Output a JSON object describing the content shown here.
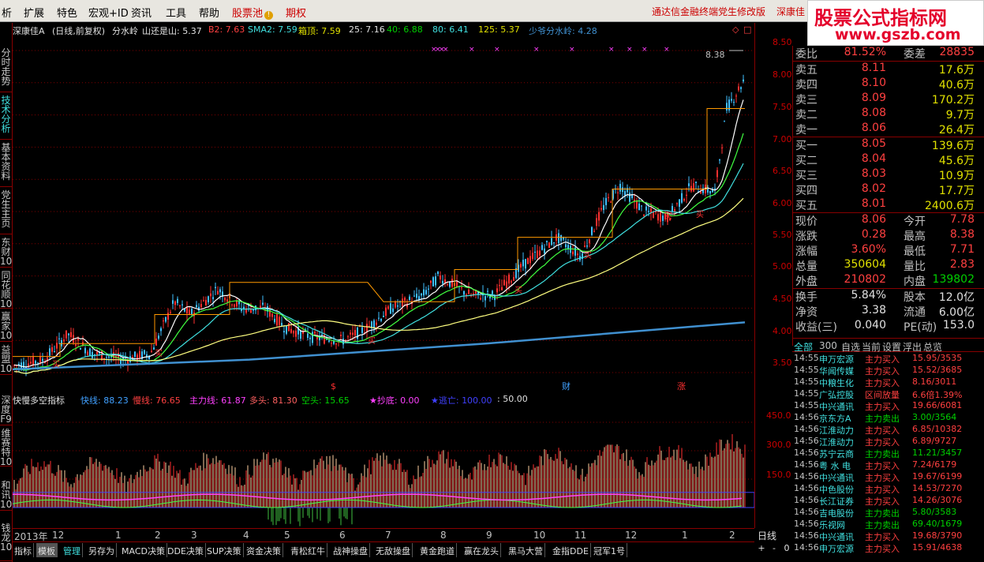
{
  "menu": [
    {
      "id": "xi",
      "label": "析"
    },
    {
      "id": "kuozhan",
      "label": "扩展"
    },
    {
      "id": "tese",
      "label": "特色"
    },
    {
      "id": "hongguan",
      "label": "宏观+ID"
    },
    {
      "id": "zixun",
      "label": "资讯"
    },
    {
      "id": "gongju",
      "label": "工具"
    },
    {
      "id": "bangzhu",
      "label": "帮助"
    }
  ],
  "stock_pool_label": "股票池",
  "rights_label": "期权",
  "top_note": "通达信金融终端党生修改版",
  "top_user": "深康佳",
  "logo": {
    "line1": "股票公式指标网",
    "line2": "www.gszb.com"
  },
  "left_tabs": [
    "分时走势",
    "技术分析",
    "基本资料",
    "党生主页",
    "东财10",
    "同花顺10",
    "赢家10",
    "益盟10",
    "深度F9",
    "维赛特10",
    "和讯10",
    "钱龙10"
  ],
  "chart_header": {
    "title": "深康佳A",
    "mode": "(日线,前复权)",
    "formula": "分水岭",
    "b1": "山还是山: 5.37",
    "b2": "B2: 7.63",
    "sma2": "SMA2: 7.59",
    "box": "箱顶: 7.59",
    "m25": "25: 7.16",
    "m40": "40: 6.88",
    "m80": "80: 6.41",
    "m125": "125: 5.37",
    "sfs": "少爷分水岭: 4.28"
  },
  "price_axis": [
    "8.50",
    "8.00",
    "7.50",
    "7.00",
    "6.50",
    "6.00",
    "5.50",
    "5.00",
    "4.50",
    "4.00",
    "3.50"
  ],
  "high_label": "8.38",
  "event_marks": {
    "s": "$",
    "cai": "财",
    "zhang": "涨"
  },
  "buy_labels": [
    "买",
    "买",
    "买",
    "买",
    "买",
    "买",
    "买"
  ],
  "sub_header": {
    "name": "快慢多空指标",
    "fast": "快线: 88.23",
    "slow": "慢线: 76.65",
    "main": "主力线: 61.87",
    "long": "多头: 81.30",
    "short": "空头: 15.65",
    "bottom": "★抄底: 0.00",
    "escape": "★逃亡: 100.00",
    "fifty": ": 50.00"
  },
  "sub_axis": [
    "450.0",
    "300.0",
    "150.0"
  ],
  "date_labels": [
    "2013年",
    "12",
    "1",
    "2",
    "3",
    "4",
    "5",
    "6",
    "7",
    "8",
    "9",
    "10",
    "11",
    "12",
    "1",
    "2"
  ],
  "period": "日线",
  "bottom_tabs": [
    "指标",
    "模板",
    "管理",
    "另存为",
    "MACD决策",
    "DDE决策",
    "SUP决策",
    "资金决策",
    "青松红牛",
    "战神操盘",
    "无敌操盘",
    "黄金跑道",
    "赢在龙头",
    "黑马大营",
    "金指DDE",
    "冠军1号"
  ],
  "bottom_ctrls": [
    "+",
    "-",
    "0"
  ],
  "quote": {
    "ratio": {
      "l1": "委比",
      "v1": "81.52%",
      "l2": "委差",
      "v2": "28835"
    },
    "asks": [
      {
        "label": "卖五",
        "price": "8.11",
        "vol": "17.6万"
      },
      {
        "label": "卖四",
        "price": "8.10",
        "vol": "40.6万"
      },
      {
        "label": "卖三",
        "price": "8.09",
        "vol": "170.2万"
      },
      {
        "label": "卖二",
        "price": "8.08",
        "vol": "9.7万"
      },
      {
        "label": "卖一",
        "price": "8.06",
        "vol": "26.4万"
      }
    ],
    "bids": [
      {
        "label": "买一",
        "price": "8.05",
        "vol": "139.6万"
      },
      {
        "label": "买二",
        "price": "8.04",
        "vol": "45.6万"
      },
      {
        "label": "买三",
        "price": "8.03",
        "vol": "10.9万"
      },
      {
        "label": "买四",
        "price": "8.02",
        "vol": "17.7万"
      },
      {
        "label": "买五",
        "price": "8.01",
        "vol": "2400.6万"
      }
    ],
    "stats": [
      {
        "l1": "现价",
        "v1": "8.06",
        "l2": "今开",
        "v2": "7.78",
        "c1": "red",
        "c2": "red"
      },
      {
        "l1": "涨跌",
        "v1": "0.28",
        "l2": "最高",
        "v2": "8.38",
        "c1": "red",
        "c2": "red"
      },
      {
        "l1": "涨幅",
        "v1": "3.60%",
        "l2": "最低",
        "v2": "7.71",
        "c1": "red",
        "c2": "red"
      },
      {
        "l1": "总量",
        "v1": "350604",
        "l2": "量比",
        "v2": "2.83",
        "c1": "yel",
        "c2": "red"
      },
      {
        "l1": "外盘",
        "v1": "210802",
        "l2": "内盘",
        "v2": "139802",
        "c1": "red",
        "c2": "grn"
      }
    ],
    "stats2": [
      {
        "l1": "换手",
        "v1": "5.84%",
        "l2": "股本",
        "v2": "12.0亿"
      },
      {
        "l1": "净资",
        "v1": "3.38",
        "l2": "流通",
        "v2": "6.00亿"
      },
      {
        "l1": "收益(三)",
        "v1": "0.040",
        "l2": "PE(动)",
        "v2": "153.0"
      }
    ]
  },
  "tape_header": [
    "全部",
    "300",
    "自选",
    "当前",
    "设置",
    "浮出",
    "总览"
  ],
  "tape": [
    {
      "t": "14:55",
      "name": "申万宏源",
      "act": "主力买入",
      "val": "15.95/3535",
      "c": "red"
    },
    {
      "t": "14:55",
      "name": "华闻传媒",
      "act": "主力买入",
      "val": "15.52/3685",
      "c": "red"
    },
    {
      "t": "14:55",
      "name": "中粮生化",
      "act": "主力买入",
      "val": "8.16/3011",
      "c": "red"
    },
    {
      "t": "14:55",
      "name": "广弘控股",
      "act": "区间放量",
      "val": "6.6倍1.39%",
      "c": "red"
    },
    {
      "t": "14:55",
      "name": "中兴通讯",
      "act": "主力买入",
      "val": "19.66/6081",
      "c": "red"
    },
    {
      "t": "14:56",
      "name": "京东方A",
      "act": "主力卖出",
      "val": "3.00/3564",
      "c": "grn"
    },
    {
      "t": "14:56",
      "name": "江淮动力",
      "act": "主力买入",
      "val": "6.85/10382",
      "c": "red"
    },
    {
      "t": "14:56",
      "name": "江淮动力",
      "act": "主力买入",
      "val": "6.89/9727",
      "c": "red"
    },
    {
      "t": "14:56",
      "name": "苏宁云商",
      "act": "主力卖出",
      "val": "11.21/3457",
      "c": "grn"
    },
    {
      "t": "14:56",
      "name": "粤 水 电",
      "act": "主力买入",
      "val": "7.24/6179",
      "c": "red"
    },
    {
      "t": "14:56",
      "name": "中兴通讯",
      "act": "主力买入",
      "val": "19.67/6199",
      "c": "red"
    },
    {
      "t": "14:56",
      "name": "中色股份",
      "act": "主力买入",
      "val": "14.53/7270",
      "c": "red"
    },
    {
      "t": "14:56",
      "name": "长江证券",
      "act": "主力买入",
      "val": "14.26/3076",
      "c": "red"
    },
    {
      "t": "14:56",
      "name": "吉电股份",
      "act": "主力卖出",
      "val": "5.80/3583",
      "c": "grn"
    },
    {
      "t": "14:56",
      "name": "乐视网",
      "act": "主力卖出",
      "val": "69.40/1679",
      "c": "grn"
    },
    {
      "t": "14:56",
      "name": "中兴通讯",
      "act": "主力买入",
      "val": "19.68/3790",
      "c": "red"
    },
    {
      "t": "14:56",
      "name": "申万宏源",
      "act": "主力买入",
      "val": "15.91/4638",
      "c": "red"
    }
  ],
  "colors": {
    "up": "#ff3030",
    "down": "#40c0ff",
    "ma25": "#ffffff",
    "ma40": "#40ff40",
    "ma80": "#40e0e0",
    "ma125": "#ffff80",
    "sfs": "#4090d0",
    "box": "#ff9900",
    "accent": "#c00000"
  }
}
